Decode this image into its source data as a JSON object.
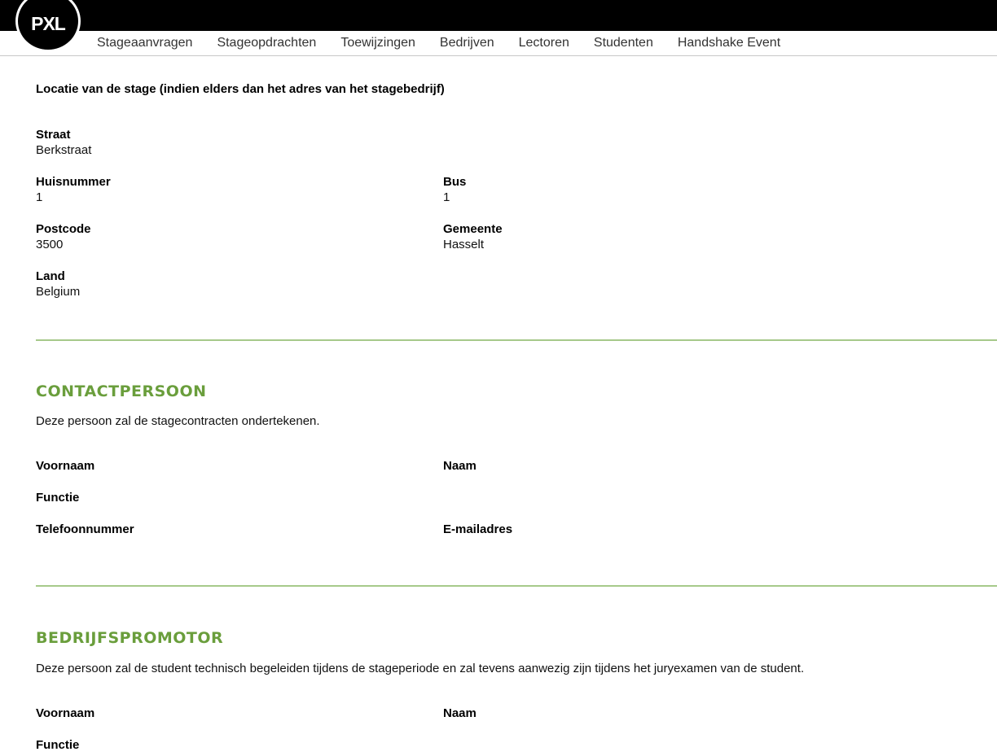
{
  "logo": "PXL",
  "nav": [
    "Stageaanvragen",
    "Stageopdrachten",
    "Toewijzingen",
    "Bedrijven",
    "Lectoren",
    "Studenten",
    "Handshake Event"
  ],
  "locatie": {
    "title": "Locatie van de stage (indien elders dan het adres van het stagebedrijf)",
    "straat_label": "Straat",
    "straat": "Berkstraat",
    "huisnummer_label": "Huisnummer",
    "huisnummer": "1",
    "bus_label": "Bus",
    "bus": "1",
    "postcode_label": "Postcode",
    "postcode": "3500",
    "gemeente_label": "Gemeente",
    "gemeente": "Hasselt",
    "land_label": "Land",
    "land": "Belgium"
  },
  "contact": {
    "heading": "CONTACTPERSOON",
    "desc": "Deze persoon zal de stagecontracten ondertekenen.",
    "voornaam_label": "Voornaam",
    "naam_label": "Naam",
    "functie_label": "Functie",
    "telefoon_label": "Telefoonnummer",
    "email_label": "E-mailadres"
  },
  "promotor": {
    "heading": "BEDRIJFSPROMOTOR",
    "desc": "Deze persoon zal de student technisch begeleiden tijdens de stageperiode en zal tevens aanwezig zijn tijdens het juryexamen van de student.",
    "voornaam_label": "Voornaam",
    "naam_label": "Naam",
    "functie_label": "Functie"
  }
}
